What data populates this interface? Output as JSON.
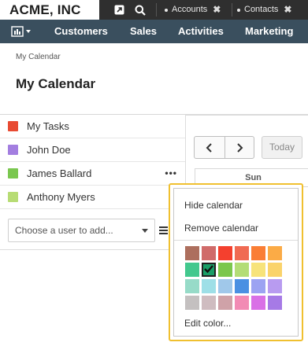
{
  "topbar": {
    "logo": "ACME, INC",
    "icons": [
      "external-link-icon",
      "search-icon"
    ],
    "tabs": [
      {
        "label": "Accounts",
        "close": "✖"
      },
      {
        "label": "Contacts",
        "close": "✖"
      }
    ]
  },
  "navbar": {
    "dashboard_icon": "bar-chart-icon",
    "items": [
      "Customers",
      "Sales",
      "Activities",
      "Marketing"
    ]
  },
  "breadcrumb": "My Calendar",
  "page_title": "My Calendar",
  "calendars": [
    {
      "label": "My Tasks",
      "color": "#e84a32"
    },
    {
      "label": "John Doe",
      "color": "#a37ee0"
    },
    {
      "label": "James Ballard",
      "color": "#7ac74f",
      "more": "•••"
    },
    {
      "label": "Anthony Myers",
      "color": "#b7dc74"
    }
  ],
  "user_select": {
    "placeholder": "Choose a user to add..."
  },
  "calendar_nav": {
    "prev": "‹",
    "next": "›",
    "today": "Today"
  },
  "calendar_header": {
    "day": "Sun"
  },
  "popup": {
    "hide": "Hide calendar",
    "remove": "Remove calendar",
    "edit_color": "Edit color...",
    "selected_index": 7,
    "palette": [
      "#ad6f5e",
      "#d06b6a",
      "#f4402e",
      "#f06a52",
      "#fa7e35",
      "#fbab46",
      "#43c88e",
      "#1a9e67",
      "#7bc74d",
      "#b3dd76",
      "#f7e37b",
      "#fad36b",
      "#97dbc8",
      "#9edfe7",
      "#a0c8ea",
      "#4a90e2",
      "#9ca3f2",
      "#b89bf0",
      "#c4c0c0",
      "#cfbcc0",
      "#cfa2a8",
      "#f28bb4",
      "#d970e6",
      "#a67ae6"
    ]
  }
}
